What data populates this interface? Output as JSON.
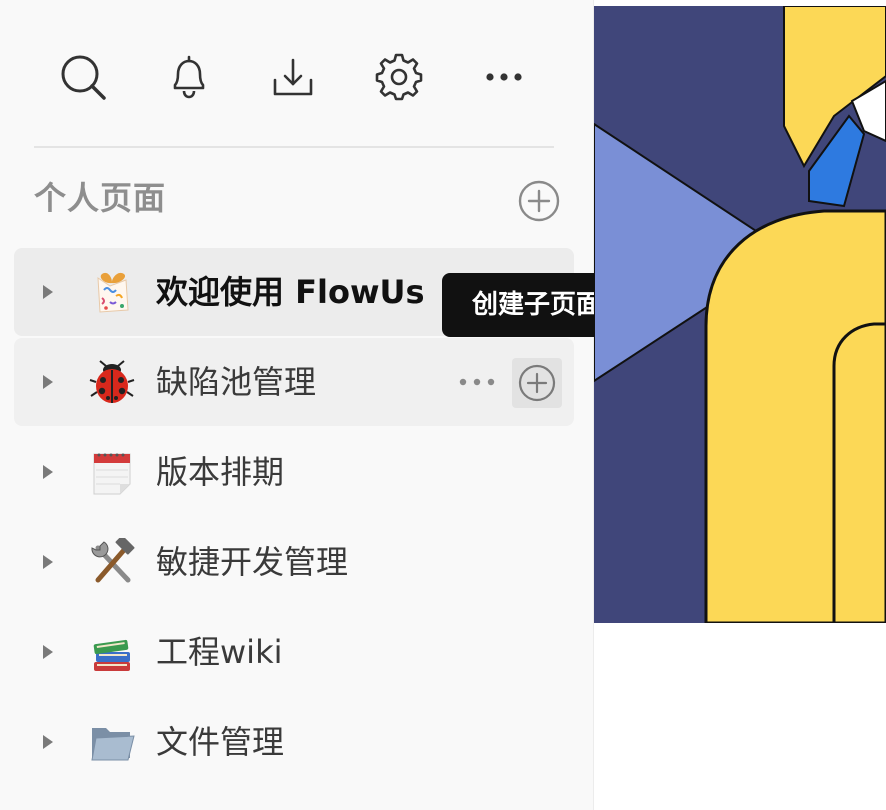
{
  "toolbar": {
    "icons": [
      "search-icon",
      "bell-icon",
      "download-icon",
      "gear-icon",
      "more-horizontal-icon"
    ]
  },
  "section": {
    "title": "个人页面",
    "add_icon": "plus-circle-icon"
  },
  "pages": [
    {
      "icon": "gift-confetti-emoji",
      "label": "欢迎使用 FlowUs",
      "state": "selected"
    },
    {
      "icon": "ladybug-emoji",
      "label": "缺陷池管理",
      "state": "hovered"
    },
    {
      "icon": "calendar-emoji",
      "label": "版本排期",
      "state": "normal"
    },
    {
      "icon": "hammer-wrench-emoji",
      "label": "敏捷开发管理",
      "state": "normal"
    },
    {
      "icon": "books-emoji",
      "label": "工程wiki",
      "state": "normal"
    },
    {
      "icon": "folder-emoji",
      "label": "文件管理",
      "state": "normal"
    }
  ],
  "row_actions": {
    "more_icon": "more-horizontal-icon",
    "add_icon": "plus-circle-icon"
  },
  "tooltip": {
    "text": "创建子页面"
  },
  "colors": {
    "sidebar_bg": "#f9f9f9",
    "selected_row": "#ececec",
    "tooltip_bg": "#111111",
    "cover_navy": "#40467a",
    "cover_periwinkle": "#7a8fd6",
    "cover_yellow": "#fcd856",
    "cover_blue": "#2e7ae0"
  }
}
